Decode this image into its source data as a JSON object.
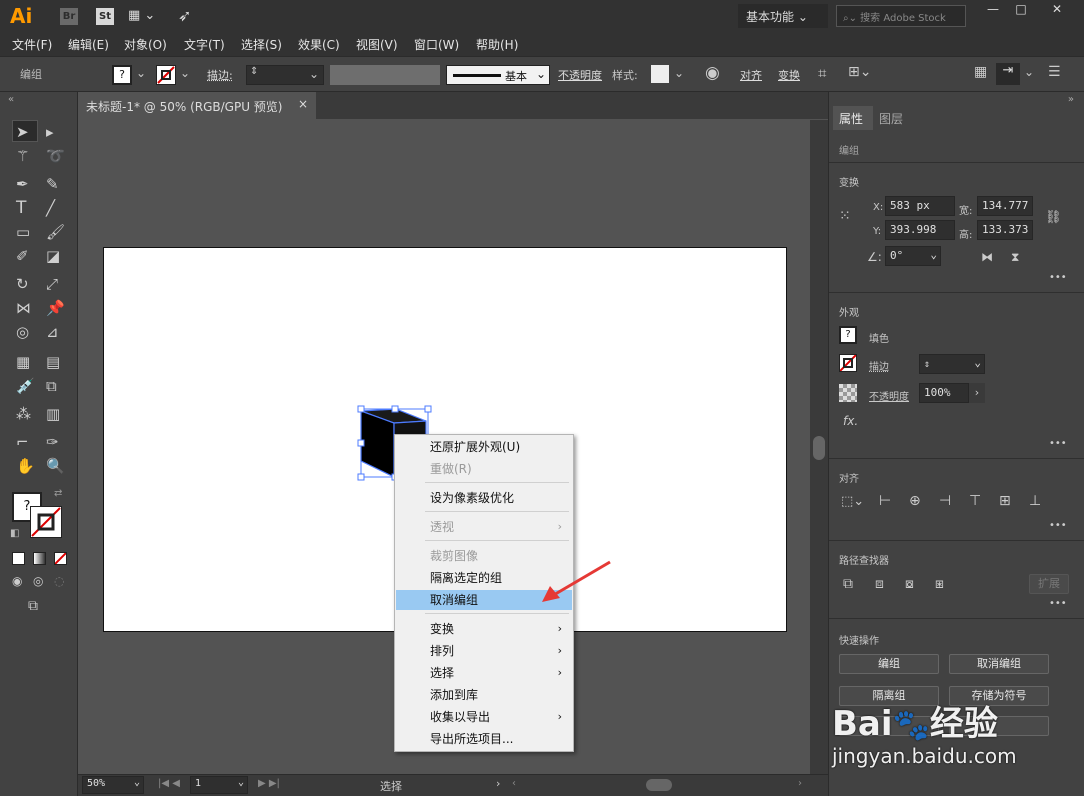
{
  "app": {
    "logo": "Ai",
    "br": "Br",
    "st": "St",
    "workspace": "基本功能",
    "search_placeholder": "搜索 Adobe Stock"
  },
  "window": {
    "min": "—",
    "max": "□",
    "close": "✕"
  },
  "menu": [
    "文件(F)",
    "编辑(E)",
    "对象(O)",
    "文字(T)",
    "选择(S)",
    "效果(C)",
    "视图(V)",
    "窗口(W)",
    "帮助(H)"
  ],
  "control": {
    "group_label": "编组",
    "fill_q": "?",
    "stroke_label": "描边",
    "stroke_style": "基本",
    "opacity_label": "不透明度",
    "style_label": "样式",
    "align": "对齐",
    "transform": "变换"
  },
  "document": {
    "tab_title": "未标题-1* @ 50% (RGB/GPU 预览)",
    "close": "×"
  },
  "status": {
    "zoom": "50%",
    "page": "1",
    "tool": "选择"
  },
  "context_menu": {
    "items": [
      {
        "label": "还原扩展外观(U)",
        "disabled": false
      },
      {
        "label": "重做(R)",
        "disabled": true
      },
      {
        "label": "设为像素级优化",
        "disabled": false
      },
      {
        "label": "透视",
        "disabled": true,
        "sub": "›"
      },
      {
        "label": "裁剪图像",
        "disabled": true
      },
      {
        "label": "隔离选定的组",
        "disabled": false
      },
      {
        "label": "取消编组",
        "disabled": false,
        "highlighted": true
      },
      {
        "label": "变换",
        "disabled": false,
        "sub": "›"
      },
      {
        "label": "排列",
        "disabled": false,
        "sub": "›"
      },
      {
        "label": "选择",
        "disabled": false,
        "sub": "›"
      },
      {
        "label": "添加到库",
        "disabled": false
      },
      {
        "label": "收集以导出",
        "disabled": false,
        "sub": "›"
      },
      {
        "label": "导出所选项目...",
        "disabled": false
      }
    ],
    "highlight_color": "#99c9f2"
  },
  "panel": {
    "tabs": [
      "属性",
      "图层"
    ],
    "group": "编组",
    "transform_title": "变换",
    "x_label": "X:",
    "x_value": "583 px",
    "y_label": "Y:",
    "y_value": "393.998",
    "w_label": "宽:",
    "w_value": "134.777",
    "h_label": "高:",
    "h_value": "133.373",
    "angle_value": "0°",
    "appearance_title": "外观",
    "fill_label": "填色",
    "fill_q": "?",
    "stroke_label": "描边",
    "opacity_label": "不透明度",
    "opacity_value": "100%",
    "fx": "fx.",
    "align_title": "对齐",
    "pathfinder_title": "路径查找器",
    "expand": "扩展",
    "quick_title": "快速操作",
    "quick_buttons": [
      "编组",
      "取消编组",
      "隔离组",
      "存储为符号"
    ],
    "more": "•••"
  },
  "watermark": {
    "text1": "Bai",
    "text2": "经验",
    "url": "jingyan.baidu.com"
  },
  "colors": {
    "accent": "#4c7bff",
    "arrow": "#e53935",
    "ai_logo": "#ff9a00"
  }
}
